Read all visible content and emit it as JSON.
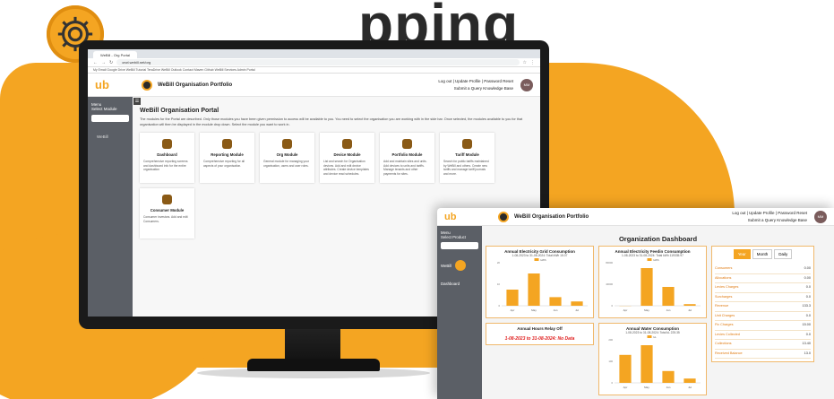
{
  "headline": "pping",
  "browser": {
    "tab_title": "WeBill - Org Portal",
    "url": "orwl.webill.net/org",
    "bookmarks": "My Email  Google Drive  WeBill Tutorial  TeraDrive  WeBill Outlook  Contact  Maven  Github  WeBill Services  Admin Portal"
  },
  "app": {
    "logo_text": "ub",
    "portal_title": "WeBill Organisation Portfolio",
    "header_links_line1": "Log out | Update Profile | Password Reset",
    "header_links_line2": "Submit a Query   Knowledge Base",
    "avatar_initials": "MM"
  },
  "sidebar": {
    "menu_label": "Menu",
    "select_label": "Select Module",
    "item": "WeBill"
  },
  "main": {
    "title": "WeBill Organisation Portal",
    "description": "The modules for the Portal are described. Only those modules you have been given permission to access will be available to you. You need to select the organisation you are working with in the side bar. Once selected, the modules available to you for that organisation will then be displayed in the module drop down. Select the module you want to work in.",
    "cards": [
      {
        "title": "Dashboard",
        "desc": "Comprehensive reporting screens and dashboard info for the entire organisation"
      },
      {
        "title": "Reporting Module",
        "desc": "Comprehensive reporting for all aspects of your organisation."
      },
      {
        "title": "Org Module",
        "desc": "General module for managing your organisation, users and user roles."
      },
      {
        "title": "Device Module",
        "desc": "List and search for Organisation devices. Add and edit device attributes. Create device templates and device read schedules."
      },
      {
        "title": "Portfolio Module",
        "desc": "Add and maintain sites and units. Add devices to units and tariffs. Manage tenants and other payments for sites."
      },
      {
        "title": "Tariff Module",
        "desc": "Search for public tariffs maintained by WeBill and others. Create new tariffs and manage tariff journals and more."
      },
      {
        "title": "Consumer Module",
        "desc": "Consumer investors. Add and edit Consumers."
      }
    ]
  },
  "dashboard": {
    "logo_text": "ub",
    "portal_title": "WeBill Organisation Portfolio",
    "header_links_line1": "Log out | Update Profile | Password Reset",
    "header_links_line2": "Submit a Query   Knowledge Base",
    "avatar_initials": "MM",
    "side_menu": "Menu",
    "side_select": "Select Product",
    "side_item1": "WeBill",
    "side_item2": "Dashboard",
    "title": "Organization Dashboard",
    "relay_title": "Annual Hours Relay Off",
    "relay_text": "1-08-2023 to 31-08-2024: No Data",
    "period_buttons": [
      "Year",
      "Month",
      "Daily"
    ],
    "stats": [
      {
        "label": "Consumers",
        "value": "0.00"
      },
      {
        "label": "Allocations",
        "value": "0.00"
      },
      {
        "label": "Levies Charges",
        "value": "0.0"
      },
      {
        "label": "Surcharges",
        "value": "0.0"
      },
      {
        "label": "Revenue",
        "value": "133.3"
      },
      {
        "label": "Unit Charges",
        "value": "0.0"
      },
      {
        "label": "Fix Charges",
        "value": "15.00"
      },
      {
        "label": "Levies Collected",
        "value": "0.0"
      },
      {
        "label": "Collections",
        "value": "13.40"
      },
      {
        "label": "Received Balance",
        "value": "13.0"
      }
    ]
  },
  "chart_data": [
    {
      "type": "bar",
      "title": "Annual Electricity Grid Consumption",
      "subtitle": "1-08-2023 to 31-08-2024: Total kWh 15.07",
      "categories": [
        "Apr",
        "May",
        "Jun",
        "Jul"
      ],
      "values": [
        7.5,
        15.0,
        4.0,
        2.0
      ],
      "series_name": "kWh",
      "ylim": [
        0,
        20
      ]
    },
    {
      "type": "bar",
      "title": "Annual Electricity Feedin Consumption",
      "subtitle": "1-08-2023 to 31-08-2024: Total kWh 119335.97",
      "categories": [
        "Apr",
        "May",
        "Jun",
        "Jul"
      ],
      "values": [
        0,
        70000,
        35000,
        3000
      ],
      "series_name": "kWh",
      "ylim": [
        0,
        80000
      ]
    },
    {
      "type": "bar",
      "title": "Annual Water Consumption",
      "subtitle": "1-08-2023 to 31-08-2024: Total kL 225.35",
      "categories": [
        "Apr",
        "May",
        "Jun",
        "Jul"
      ],
      "values": [
        130,
        175,
        55,
        20
      ],
      "series_name": "kL",
      "ylim": [
        0,
        200
      ]
    }
  ]
}
